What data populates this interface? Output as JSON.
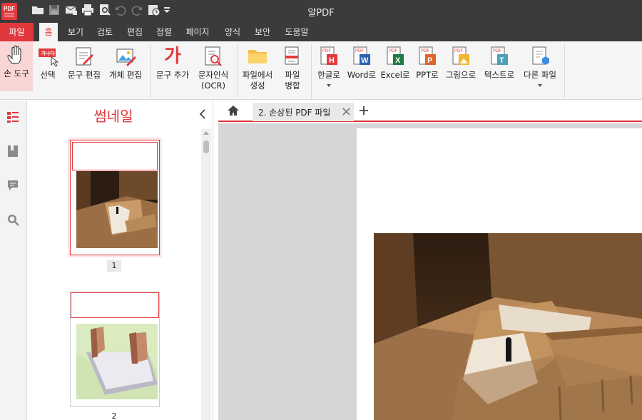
{
  "app": {
    "logo_text": "PDF",
    "title": "알PDF"
  },
  "quick_access": [
    "open-folder-icon",
    "save-icon",
    "email-icon",
    "print-icon",
    "print-preview-icon",
    "undo-icon",
    "redo-icon",
    "history-icon",
    "dropdown-icon"
  ],
  "menu": {
    "file": "파일",
    "items": [
      "홈",
      "보기",
      "검토",
      "편집",
      "정렬",
      "페이지",
      "양식",
      "보안",
      "도움말"
    ],
    "active": "홈"
  },
  "ribbon": {
    "hand_tool": "손 도구",
    "select": "선택",
    "select_badge": "가나다",
    "edit_text": "문구 편집",
    "edit_object": "개체 편집",
    "add_text": "문구 추가",
    "add_text_glyph": "가",
    "ocr": [
      "문자인식",
      "(OCR)"
    ],
    "create_from_file": [
      "파일에서",
      "생성"
    ],
    "merge": [
      "파일",
      "병합"
    ],
    "to_hangul": "한글로",
    "to_word": "Word로",
    "to_excel": "Excel로",
    "to_ppt": "PPT로",
    "to_image": "그림으로",
    "to_text": "텍스트로",
    "other_file": "다른 파일",
    "convert_badges": {
      "hangul": "H",
      "word": "W",
      "excel": "X",
      "ppt": "P",
      "text": "T",
      "pdf": "PDF"
    }
  },
  "sidebar": [
    "thumbnail-icon",
    "bookmark-icon",
    "comment-icon",
    "search-icon"
  ],
  "thumbnails": {
    "title": "썸네일",
    "pages": [
      "1",
      "2"
    ],
    "selected": "1"
  },
  "tabs": {
    "document": "2. 손상된 PDF 파일"
  },
  "colors": {
    "accent": "#e0383d",
    "titlebar": "#3b3b3b",
    "ribbon": "#f5f5f5",
    "workspace": "#d6d6d6"
  }
}
